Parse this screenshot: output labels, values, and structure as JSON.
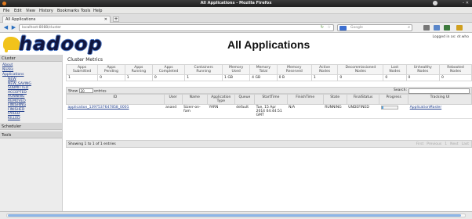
{
  "window": {
    "title": "All Applications - Mozilla Firefox",
    "controls": "–  ✕"
  },
  "menu": [
    "File",
    "Edit",
    "View",
    "History",
    "Bookmarks",
    "Tools",
    "Help"
  ],
  "tab": {
    "label": "All Applications",
    "close": "✕",
    "new": "+"
  },
  "nav": {
    "back": "◀",
    "forward": "▶",
    "url": "localhost:8088/cluster",
    "search_placeholder": "Google",
    "star": "☆",
    "reload": "↻",
    "search_icon": "⌕"
  },
  "brand": {
    "logo_text": "hadoop",
    "elephant_color": "#f1c31b"
  },
  "page": {
    "title": "All Applications",
    "login": "Logged in as: dr.who"
  },
  "sidebar": {
    "cluster_label": "Cluster",
    "links": [
      {
        "label": "About",
        "sub": false
      },
      {
        "label": "Nodes",
        "sub": false
      },
      {
        "label": "Applications",
        "sub": false
      },
      {
        "label": "NEW",
        "sub": true
      },
      {
        "label": "NEW_SAVING",
        "sub": true
      },
      {
        "label": "SUBMITTED",
        "sub": true
      },
      {
        "label": "ACCEPTED",
        "sub": true
      },
      {
        "label": "RUNNING",
        "sub": true
      },
      {
        "label": "REMOVED",
        "sub": true
      },
      {
        "label": "FINISHING",
        "sub": true
      },
      {
        "label": "FINISHED",
        "sub": true
      },
      {
        "label": "FAILED",
        "sub": true
      },
      {
        "label": "KILLED",
        "sub": true
      }
    ],
    "scheduler_label": "Scheduler",
    "tools_label": "Tools"
  },
  "metrics": {
    "title": "Cluster Metrics",
    "headers": [
      "Apps Submitted",
      "Apps Pending",
      "Apps Running",
      "Apps Completed",
      "Containers Running",
      "Memory Used",
      "Memory Total",
      "Memory Reserved",
      "Active Nodes",
      "Decommissioned Nodes",
      "Lost Nodes",
      "Unhealthy Nodes",
      "Rebooted Nodes"
    ],
    "values": [
      "1",
      "0",
      "1",
      "0",
      "1",
      "1 GB",
      "4 GB",
      "0 B",
      "1",
      "0",
      "0",
      "0",
      "0"
    ]
  },
  "controls": {
    "show_label": "Show",
    "entries_value": "20",
    "entries_label": "entries",
    "search_label": "Search:"
  },
  "apps": {
    "headers": [
      "ID",
      "User",
      "Name",
      "Application Type",
      "Queue",
      "StartTime",
      "FinishTime",
      "State",
      "FinalStatus",
      "Progress",
      "Tracking UI"
    ],
    "rows": [
      {
        "id": "application_1397537647858_0001",
        "user": "anand",
        "name": "Sizerr-on-fam",
        "type": "YARN",
        "queue": "default",
        "start": "Tue, 15 Apr 2014 04:44:51 GMT",
        "finish": "N/A",
        "state": "RUNNING",
        "final": "UNDEFINED",
        "progress": 0.1,
        "tracking": "ApplicationMaster"
      }
    ]
  },
  "footer": {
    "info": "Showing 1 to 1 of 1 entries",
    "pager": [
      "First",
      "Previous",
      "1",
      "Next",
      "Last"
    ]
  }
}
